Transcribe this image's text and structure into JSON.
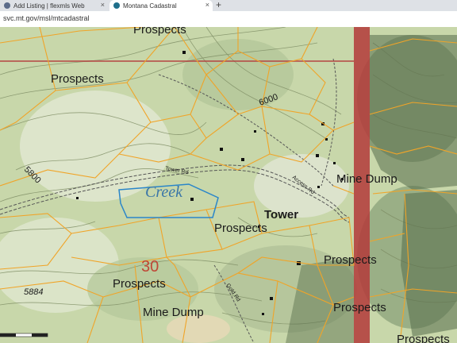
{
  "browser": {
    "tabs": [
      {
        "label": "Add Listing | flexmls Web",
        "active": false,
        "favicon_color": "#5b6b8a"
      },
      {
        "label": "Montana Cadastral",
        "active": true,
        "favicon_color": "#1f6f8b"
      }
    ],
    "new_tab_symbol": "+",
    "close_symbol": "×",
    "url": "svc.mt.gov/msl/mtcadastral"
  },
  "map": {
    "labels": {
      "prospects_1": "Prospects",
      "prospects_2": "Prospects",
      "prospects_3": "Prospects",
      "prospects_4": "Prospects",
      "prospects_5": "Prospects",
      "prospects_6": "Prospects",
      "prospects_7": "Prospects",
      "mine_dump_1": "Mine Dump",
      "mine_dump_2": "Mine Dump",
      "tower": "Tower",
      "creek": "Creek",
      "road_tower": "Tower Rd",
      "road_access": "Access Rd",
      "road_gold": "Gold Rd",
      "elev_6000": "6000",
      "elev_5800": "5800",
      "elev_5884": "5884",
      "section_30": "30"
    },
    "colors": {
      "terrain": "#c6d6a8",
      "parcel_line": "#f0a428",
      "selected_parcel": "#2a86c9",
      "boundary_band": "#b33a3a"
    }
  }
}
